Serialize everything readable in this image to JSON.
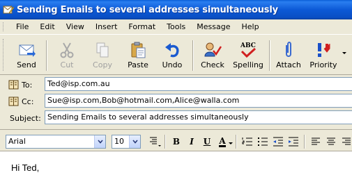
{
  "window": {
    "title": "Sending Emails to several addresses simultaneously",
    "icon": "envelope-pencil-icon"
  },
  "menu": [
    "File",
    "Edit",
    "View",
    "Insert",
    "Format",
    "Tools",
    "Message",
    "Help"
  ],
  "toolbar": {
    "send": "Send",
    "cut": "Cut",
    "copy": "Copy",
    "paste": "Paste",
    "undo": "Undo",
    "check": "Check",
    "spelling": "Spelling",
    "spelling_badge": "ABC",
    "attach": "Attach",
    "priority": "Priority"
  },
  "headers": {
    "to_label": "To:",
    "to_value": "Ted@isp.com.au",
    "cc_label": "Cc:",
    "cc_value": "Sue@isp.com,Bob@hotmail.com,Alice@walla.com",
    "subject_label": "Subject:",
    "subject_value": "Sending Emails to several addresses simultaneously"
  },
  "format": {
    "font": "Arial",
    "size": "10",
    "bold": "B",
    "italic": "I",
    "underline": "U",
    "font_color": "A"
  },
  "body": {
    "greeting": "Hi Ted,"
  },
  "colors": {
    "titlebar": "#0a5fd8",
    "window_bg": "#ece9d8",
    "field_border": "#7f9db9"
  }
}
